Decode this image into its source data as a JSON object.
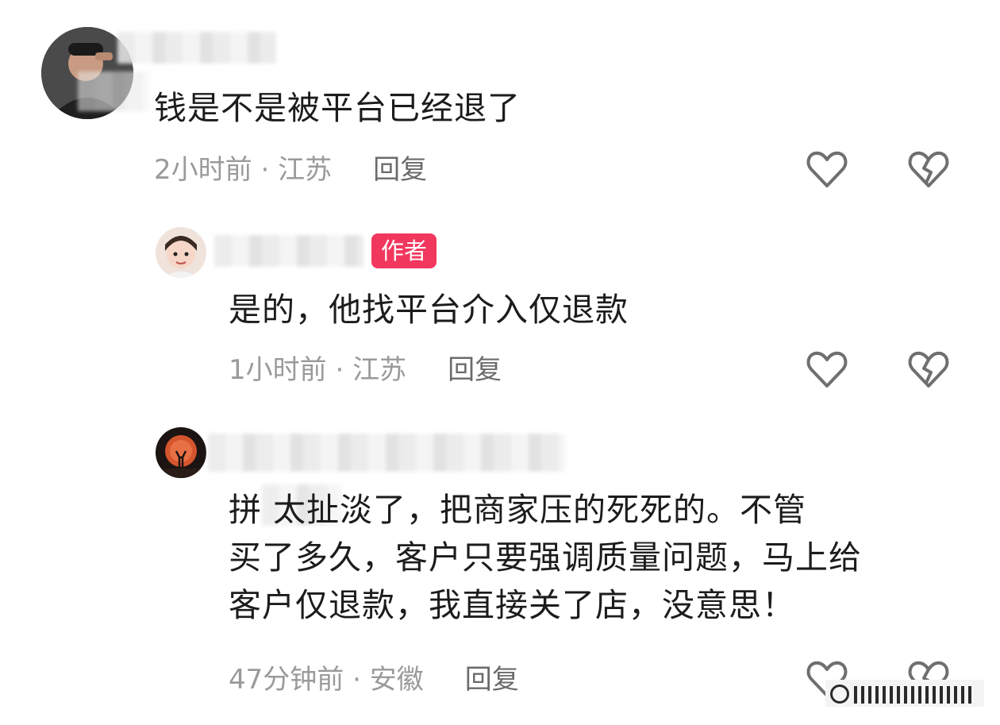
{
  "comments": [
    {
      "text": "钱是不是被平台已经退了",
      "time": "2小时前",
      "location": "江苏",
      "reply_label": "回复"
    },
    {
      "badge": "作者",
      "text": "是的，他找平台介入仅退款",
      "time": "1小时前",
      "location": "江苏",
      "reply_label": "回复"
    },
    {
      "text_lines": [
        "拼     太扯淡了，把商家压的死死的。不管",
        "买了多久，客户只要强调质量问题，马上给",
        "客户仅退款，我直接关了店，没意思！"
      ],
      "time": "47分钟前",
      "location": "安徽",
      "reply_label": "回复"
    }
  ],
  "meta_separator": " · ",
  "icons": {
    "like": "heart-outline-icon",
    "dislike": "broken-heart-icon"
  },
  "colors": {
    "badge": "#f2375e",
    "meta": "#9a9a9a",
    "reply": "#6b6b6b"
  }
}
